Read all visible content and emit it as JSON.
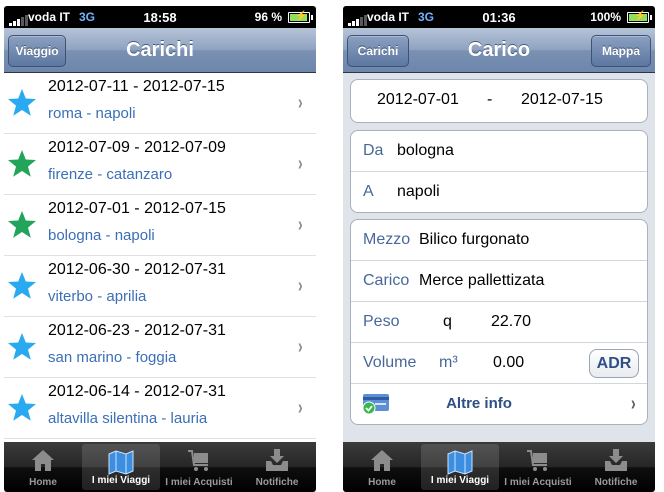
{
  "left": {
    "status": {
      "carrier": "voda IT",
      "network": "3G",
      "time": "18:58",
      "battery": "96 %",
      "battery_level": 0.96
    },
    "nav": {
      "back_label": "Viaggio",
      "title": "Carichi"
    },
    "trips": [
      {
        "dates": "2012-07-11 - 2012-07-15",
        "route": "roma - napoli",
        "star_color": "#29aaf0"
      },
      {
        "dates": "2012-07-09 - 2012-07-09",
        "route": "firenze - catanzaro",
        "star_color": "#22a55a"
      },
      {
        "dates": "2012-07-01 - 2012-07-15",
        "route": "bologna - napoli",
        "star_color": "#22a55a"
      },
      {
        "dates": "2012-06-30 - 2012-07-31",
        "route": "viterbo - aprilia",
        "star_color": "#29aaf0"
      },
      {
        "dates": "2012-06-23 - 2012-07-31",
        "route": "san marino - foggia",
        "star_color": "#29aaf0"
      },
      {
        "dates": "2012-06-14 - 2012-07-31",
        "route": "altavilla silentina - lauria",
        "star_color": "#29aaf0"
      }
    ]
  },
  "right": {
    "status": {
      "carrier": "voda IT",
      "network": "3G",
      "time": "01:36",
      "battery": "100%",
      "battery_level": 1.0
    },
    "nav": {
      "back_label": "Carichi",
      "title": "Carico",
      "right_button": "Mappa"
    },
    "dates": {
      "from": "2012-07-01",
      "sep": "-",
      "to": "2012-07-15"
    },
    "places": {
      "from_label": "Da",
      "from": "bologna",
      "to_label": "A",
      "to": "napoli"
    },
    "details": {
      "mezzo_label": "Mezzo",
      "mezzo": "Bilico furgonato",
      "carico_label": "Carico",
      "carico": "Merce pallettizata",
      "peso_label": "Peso",
      "peso_unit": "q",
      "peso": "22.70",
      "volume_label": "Volume",
      "volume_unit": "m³",
      "volume": "0.00",
      "adr_button": "ADR",
      "more_label": "Altre info"
    }
  },
  "tabs": [
    {
      "label": "Home",
      "icon": "home-icon"
    },
    {
      "label": "I miei Viaggi",
      "icon": "map-icon",
      "active": true
    },
    {
      "label": "I miei Acquisti",
      "icon": "cart-icon"
    },
    {
      "label": "Notifiche",
      "icon": "inbox-icon"
    }
  ]
}
